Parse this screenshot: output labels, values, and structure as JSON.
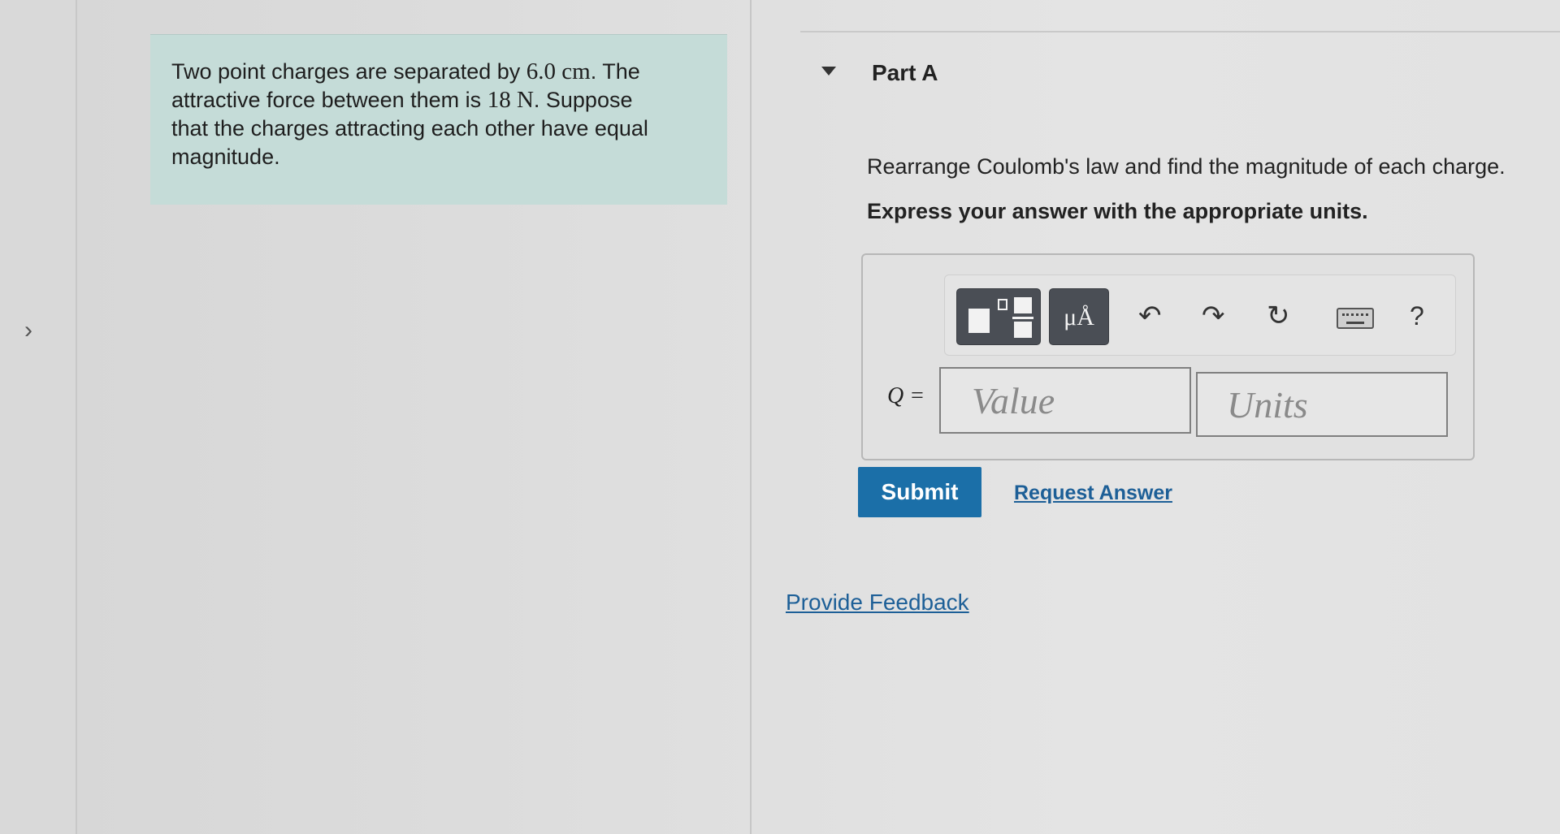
{
  "problem": {
    "line1_pre": "Two point charges are separated by ",
    "distance": "6.0 cm",
    "line1_post": ". The",
    "line2_pre": "attractive force between them is ",
    "force": "18 N",
    "line2_post": ". Suppose",
    "line3": "that the charges attracting each other have equal",
    "line4": "magnitude."
  },
  "part": {
    "title": "Part A",
    "question": "Rearrange Coulomb's law and find the magnitude of each charge.",
    "instruction": "Express your answer with the appropriate units."
  },
  "toolbar": {
    "units_symbol": "μÅ",
    "undo_glyph": "↶",
    "redo_glyph": "↷",
    "reset_glyph": "↻",
    "help_glyph": "?"
  },
  "answer": {
    "label": "Q =",
    "value_placeholder": "Value",
    "units_placeholder": "Units"
  },
  "actions": {
    "submit_label": "Submit",
    "request_answer_label": "Request Answer",
    "feedback_label": "Provide Feedback"
  },
  "colors": {
    "problem_bg": "#c5dcd8",
    "submit_bg": "#1b6fa8",
    "link": "#1d5f97"
  }
}
